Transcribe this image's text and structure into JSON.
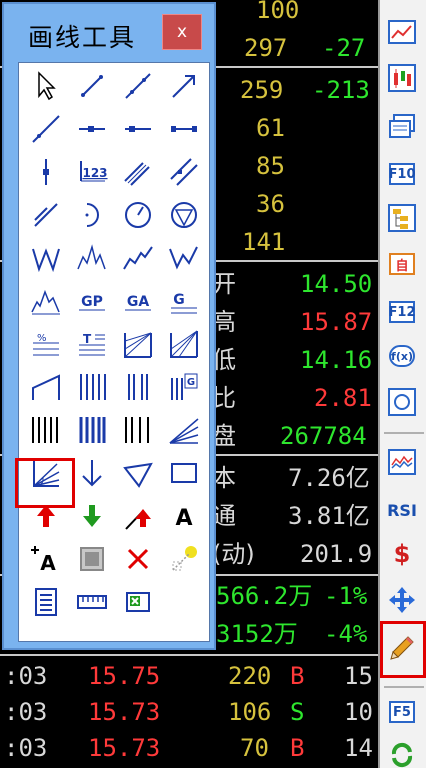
{
  "window": {
    "title": "画线工具",
    "close_label": "x"
  },
  "tools": [
    {
      "name": "pointer-icon"
    },
    {
      "name": "line-segment-icon"
    },
    {
      "name": "line-icon"
    },
    {
      "name": "arrow-line-icon"
    },
    {
      "name": "ray-icon"
    },
    {
      "name": "horizontal-segment-icon"
    },
    {
      "name": "horizontal-ray-icon"
    },
    {
      "name": "horizontal-line-icon"
    },
    {
      "name": "vertical-line-icon"
    },
    {
      "name": "price-label-icon",
      "text": "123"
    },
    {
      "name": "parallel-lines-icon"
    },
    {
      "name": "parallel-channel-icon"
    },
    {
      "name": "cross-line-icon"
    },
    {
      "name": "arc-icon"
    },
    {
      "name": "circle-icon"
    },
    {
      "name": "ellipse-icon"
    },
    {
      "name": "wave-w-icon"
    },
    {
      "name": "wave-m-icon"
    },
    {
      "name": "wave-trend-icon"
    },
    {
      "name": "wave-down-icon"
    },
    {
      "name": "elliott-wave-icon"
    },
    {
      "name": "gann-gp-icon",
      "text": "GP"
    },
    {
      "name": "gann-ga-icon",
      "text": "GA"
    },
    {
      "name": "gann-g-icon",
      "text": "G"
    },
    {
      "name": "percent-lines-icon",
      "text": "%"
    },
    {
      "name": "t-lines-icon",
      "text": "T"
    },
    {
      "name": "speed-lines-icon"
    },
    {
      "name": "gann-fan-icon"
    },
    {
      "name": "step-line-icon"
    },
    {
      "name": "fibonacci-time-icon"
    },
    {
      "name": "cycle-lines-icon"
    },
    {
      "name": "g-cycle-icon",
      "text": "G"
    },
    {
      "name": "period-lines-icon"
    },
    {
      "name": "blue-period-lines-icon"
    },
    {
      "name": "time-zone-icon"
    },
    {
      "name": "fan-lines-icon"
    },
    {
      "name": "fan-arc-icon"
    },
    {
      "name": "down-arrow-icon"
    },
    {
      "name": "triangle-icon"
    },
    {
      "name": "rectangle-icon"
    },
    {
      "name": "buy-arrow-icon"
    },
    {
      "name": "sell-arrow-icon"
    },
    {
      "name": "buy-signal-icon"
    },
    {
      "name": "text-icon",
      "text": "A"
    },
    {
      "name": "text-annotation-icon",
      "text": "A"
    },
    {
      "name": "box-icon"
    },
    {
      "name": "delete-icon"
    },
    {
      "name": "hide-icon"
    },
    {
      "name": "notes-icon"
    },
    {
      "name": "ruler-icon"
    },
    {
      "name": "excel-icon"
    }
  ],
  "quote": {
    "top": [
      {
        "vol": "100",
        "chg": ""
      },
      {
        "vol": "297",
        "chg": "-27"
      },
      {
        "vol": "259",
        "chg": "-213"
      },
      {
        "vol": "61",
        "chg": ""
      },
      {
        "vol": "85",
        "chg": ""
      },
      {
        "vol": "36",
        "chg": ""
      },
      {
        "vol": "141",
        "chg": ""
      }
    ],
    "stats": [
      {
        "label": "开",
        "value": "14.50"
      },
      {
        "label": "高",
        "value": "15.87"
      },
      {
        "label": "低",
        "value": "14.16"
      },
      {
        "label": "比",
        "value": "2.81"
      },
      {
        "label": "盘",
        "value": "267784"
      }
    ],
    "capital": [
      {
        "label": "本",
        "value": "7.26亿"
      },
      {
        "label": "通",
        "value": "3.81亿"
      },
      {
        "label": "(动)",
        "value": "201.9"
      }
    ],
    "flows": [
      {
        "amount": "566.2万",
        "pct": "-1%"
      },
      {
        "amount": "3152万",
        "pct": "-4%"
      }
    ],
    "ticks": [
      {
        "time": ":03",
        "price": "15.75",
        "vol": "220",
        "side": "B",
        "n": "15"
      },
      {
        "time": ":03",
        "price": "15.73",
        "vol": "106",
        "side": "S",
        "n": "10"
      },
      {
        "time": ":03",
        "price": "15.73",
        "vol": "70",
        "side": "B",
        "n": "14"
      }
    ]
  },
  "toolbar": {
    "items": [
      {
        "name": "chart-line-icon"
      },
      {
        "name": "candlestick-icon"
      },
      {
        "name": "windows-icon"
      },
      {
        "name": "f10-icon",
        "label": "F10"
      },
      {
        "name": "tree-icon"
      },
      {
        "name": "self-select-icon",
        "label": "自"
      },
      {
        "name": "f12-icon",
        "label": "F12"
      },
      {
        "name": "formula-icon",
        "label": "f(x)"
      },
      {
        "name": "circle-tool-icon"
      },
      {
        "name": "indicator-icon"
      },
      {
        "name": "rsi-icon",
        "label": "RSI"
      },
      {
        "name": "money-icon",
        "label": "$"
      },
      {
        "name": "move-icon"
      },
      {
        "name": "pencil-icon"
      },
      {
        "name": "f5-icon",
        "label": "F5"
      },
      {
        "name": "refresh-icon"
      }
    ]
  }
}
